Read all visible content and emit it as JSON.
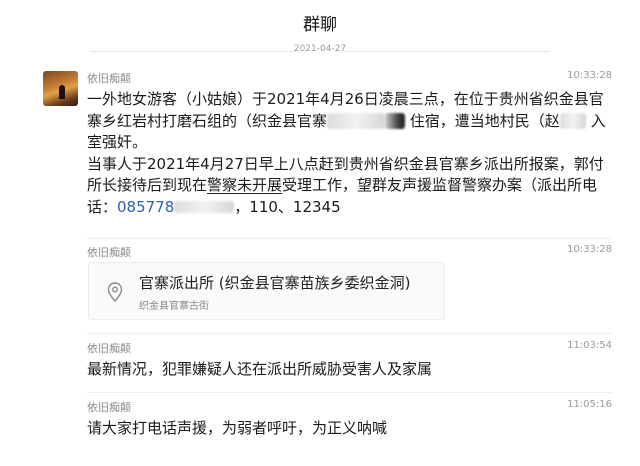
{
  "header": {
    "title": "群聊"
  },
  "date_divider": "2021-04-27",
  "messages": [
    {
      "sender": "依旧痴颠",
      "time": "10:33:28",
      "paragraph1_a": "一外地女游客（小姑娘）于2021年4月26日凌晨三点，在位于贵州省织金县官寨乡红岩村打磨石组的（织金县官寨",
      "paragraph1_b": "住宿，遭当地村民（赵",
      "paragraph1_c": "入室强奸。",
      "paragraph2_a": "当事人于2021年4月27日早上八点赶到贵州省织金县官寨乡派出所报案，郭付所长接待后到现在",
      "paragraph2_u": "警察未开展",
      "paragraph2_b": "受理工作，望群友声援监督警察办案（派出所电话：",
      "phone1": "085778",
      "phone_rest": "，110、12345"
    },
    {
      "sender": "依旧痴颠",
      "time": "10:33:28",
      "location_name": "官寨派出所 (织金县官寨苗族乡委织金洞)",
      "location_address": "织金县官寨古街"
    },
    {
      "sender": "依旧痴颠",
      "time": "11:03:54",
      "text": "最新情况，犯罪嫌疑人还在派出所威胁受害人及家属"
    },
    {
      "sender": "依旧痴颠",
      "time": "11:05:16",
      "text": "请大家打电话声援，为弱者呼吁，为正义呐喊"
    }
  ],
  "icons": {
    "avatar": "avatar-image",
    "location": "location-pin-icon"
  }
}
